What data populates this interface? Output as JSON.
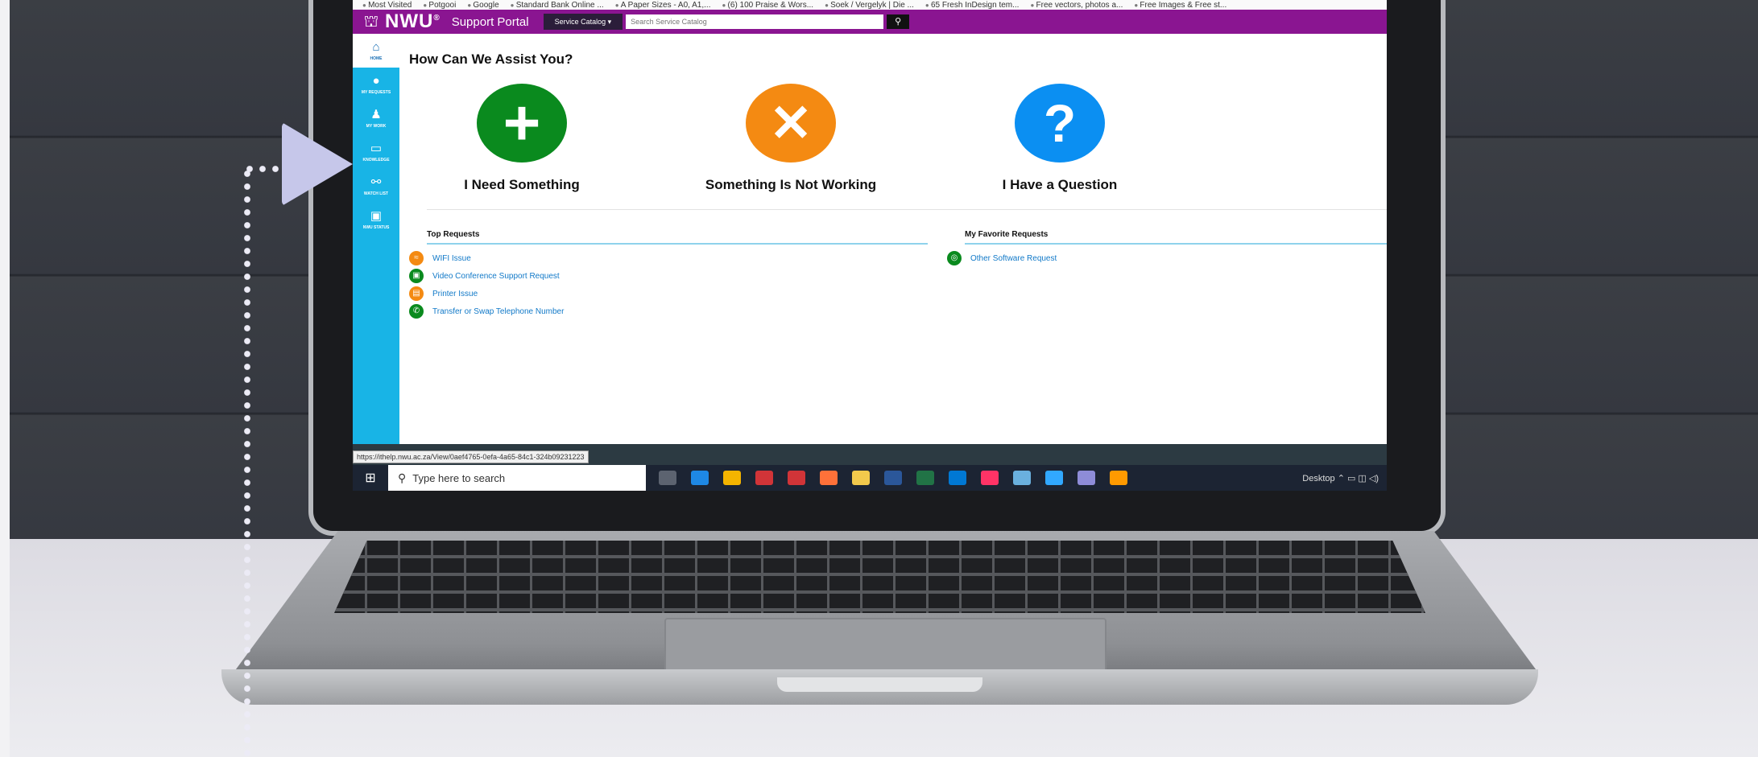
{
  "browser": {
    "bookmarks": [
      "Most Visited",
      "Potgooi",
      "Google",
      "Standard Bank Online ...",
      "A Paper Sizes - A0, A1,...",
      "(6) 100 Praise & Wors...",
      "Soek / Vergelyk | Die ...",
      "65 Fresh InDesign tem...",
      "Free vectors, photos a...",
      "Free Images & Free st..."
    ],
    "status_url": "https://ithelp.nwu.ac.za/View/0aef4765-0efa-4a65-84c1-324b09231223"
  },
  "header": {
    "logo": "NWU",
    "logo_mark": "®",
    "portal_title": "Support Portal",
    "catalog_button": "Service Catalog ▾",
    "search_placeholder": "Search Service Catalog",
    "search_icon": "magnifier-icon"
  },
  "sidenav": [
    {
      "label": "HOME",
      "icon": "⌂"
    },
    {
      "label": "MY REQUESTS",
      "icon": "●"
    },
    {
      "label": "MY WORK",
      "icon": "♟"
    },
    {
      "label": "KNOWLEDGE",
      "icon": "▭"
    },
    {
      "label": "WATCH LIST",
      "icon": "⚯"
    },
    {
      "label": "NWU STATUS",
      "icon": "▣"
    }
  ],
  "main": {
    "heading": "How Can We Assist You?",
    "actions": [
      {
        "label": "I Need Something",
        "symbol": "+",
        "color": "#0a8a1e"
      },
      {
        "label": "Something Is Not Working",
        "symbol": "✕",
        "color": "#f48a12"
      },
      {
        "label": "I Have a Question",
        "symbol": "?",
        "color": "#0b8ff2"
      }
    ],
    "top_requests_title": "Top Requests",
    "top_requests": [
      {
        "label": "WIFI Issue",
        "color": "#f48a12"
      },
      {
        "label": "Video Conference Support Request",
        "color": "#0a8a1e"
      },
      {
        "label": "Printer Issue",
        "color": "#f48a12"
      },
      {
        "label": "Transfer or Swap Telephone Number",
        "color": "#0a8a1e"
      }
    ],
    "favorites_title": "My Favorite Requests",
    "favorites": [
      {
        "label": "Other Software Request",
        "color": "#0a8a1e"
      }
    ]
  },
  "taskbar": {
    "search_text": "Type here to search",
    "tray_text": "Desktop",
    "app_colors": [
      "#5c6370",
      "#1e88e5",
      "#f4b400",
      "#d13438",
      "#d13438",
      "#ff7139",
      "#f2c94c",
      "#2b579a",
      "#217346",
      "#0078d4",
      "#ff3366",
      "#6ab0de",
      "#31a8ff",
      "#8e8cd8",
      "#ff9a00"
    ]
  },
  "colors": {
    "brand": "#8a1591",
    "sidenav": "#18b4e6",
    "link": "#1179c8"
  }
}
